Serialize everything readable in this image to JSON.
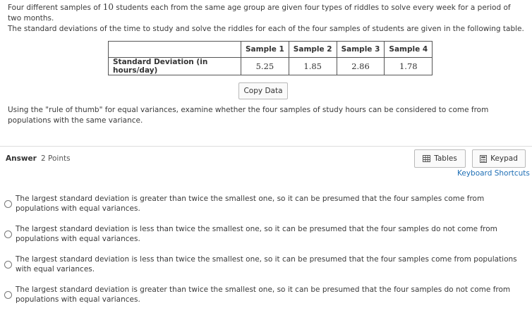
{
  "intro": {
    "line1_pre": "Four different samples of ",
    "line1_num": "10",
    "line1_post": " students each from the same age group are given four types of riddles to solve every week for a period of two months.",
    "line2": "The standard deviations of the time to study and solve the riddles for each of the four samples of students are given in the following table."
  },
  "table": {
    "headers": [
      "Sample 1",
      "Sample 2",
      "Sample 3",
      "Sample 4"
    ],
    "row_label": "Standard Deviation (in hours/day)",
    "values": [
      "5.25",
      "1.85",
      "2.86",
      "1.78"
    ]
  },
  "copy_button": "Copy Data",
  "question": "Using the \"rule of thumb\" for equal variances, examine whether the four samples of study hours can be considered to come from populations with the same variance.",
  "answer": {
    "label": "Answer",
    "points": "2 Points"
  },
  "tools": {
    "tables": "Tables",
    "keypad": "Keypad",
    "shortcuts": "Keyboard Shortcuts"
  },
  "options": [
    "The largest standard deviation is greater than twice the smallest one, so it can be presumed that the four samples come from populations with equal variances.",
    "The largest standard deviation is less than twice the smallest one, so it can be presumed that the four samples do not come from populations with equal variances.",
    "The largest standard deviation is less than twice the smallest one, so it can be presumed that the four samples come from populations with equal variances.",
    "The largest standard deviation is greater than twice the smallest one, so it can be presumed that the four samples do not come from populations with equal variances."
  ],
  "colors": {
    "link": "#1f6fb5",
    "divider": "#dddddd"
  }
}
